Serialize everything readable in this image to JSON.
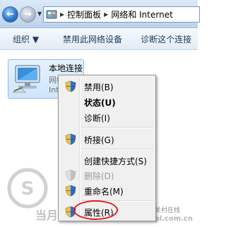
{
  "address_bar": {
    "breadcrumbs": [
      "控制面板",
      "网络和 Internet"
    ]
  },
  "toolbar": {
    "organize_label": "组织 ▼",
    "disable_device_label": "禁用此网络设备",
    "diagnose_label": "诊断这个连接"
  },
  "connection": {
    "name": "本地连接",
    "status_line": "网络",
    "device_line": "Intel"
  },
  "context_menu": {
    "items": [
      {
        "label": "禁用(B)"
      },
      {
        "label": "状态(U)"
      },
      {
        "label": "诊断(I)"
      },
      {
        "label": "桥接(G)"
      },
      {
        "label": "创建快捷方式(S)"
      },
      {
        "label": "删除(D)"
      },
      {
        "label": "重命名(M)"
      },
      {
        "label": "属性(R)"
      }
    ]
  },
  "watermarks": {
    "left_text": "当月玩物",
    "zol_name": "中关村在线",
    "zol_url": "zol.com.cn"
  },
  "colors": {
    "highlight_ring": "#e41b1b",
    "toolbar_text": "#1e395b"
  }
}
